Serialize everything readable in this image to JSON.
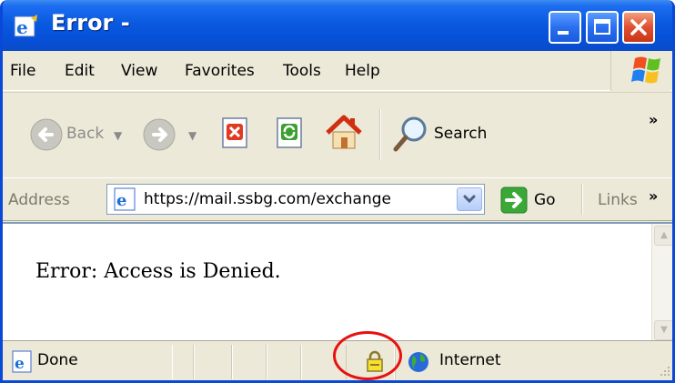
{
  "window": {
    "title": "Error -",
    "controls": [
      "minimize",
      "maximize",
      "close"
    ]
  },
  "menu": {
    "items": [
      {
        "label": "File"
      },
      {
        "label": "Edit"
      },
      {
        "label": "View"
      },
      {
        "label": "Favorites"
      },
      {
        "label": "Tools"
      },
      {
        "label": "Help"
      }
    ]
  },
  "toolbar": {
    "back_label": "Back",
    "search_label": "Search",
    "more": "»"
  },
  "address": {
    "label": "Address",
    "url": "https://mail.ssbg.com/exchange",
    "go_label": "Go",
    "links_label": "Links",
    "more": "»"
  },
  "content": {
    "message": "Error: Access is Denied."
  },
  "status": {
    "text": "Done",
    "zone": "Internet",
    "lock_icon": "padlock-icon",
    "highlight_color": "#e81010"
  },
  "colors": {
    "titlebar": "#0a5ae0",
    "chrome": "#ece9d8"
  }
}
